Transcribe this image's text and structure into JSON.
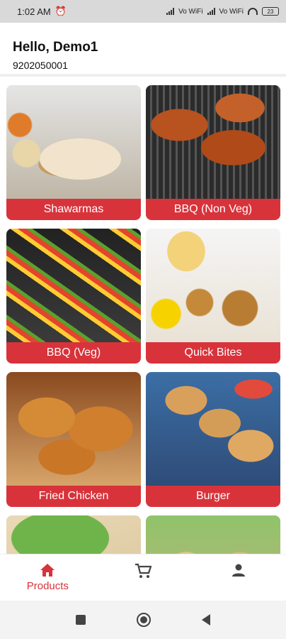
{
  "status_bar": {
    "time": "1:02 AM",
    "battery": "23",
    "net1": "Vo WiFi",
    "net2": "Vo WiFi"
  },
  "header": {
    "greeting": "Hello, Demo1",
    "phone": "9202050001"
  },
  "categories": [
    {
      "label": "Shawarmas",
      "icon": "shawarma-image"
    },
    {
      "label": "BBQ (Non Veg)",
      "icon": "bbq-nonveg-image"
    },
    {
      "label": "BBQ (Veg)",
      "icon": "bbq-veg-image"
    },
    {
      "label": "Quick Bites",
      "icon": "quick-bites-image"
    },
    {
      "label": "Fried Chicken",
      "icon": "fried-chicken-image"
    },
    {
      "label": "Burger",
      "icon": "burger-image"
    },
    {
      "label": "",
      "icon": "sandwich-image"
    },
    {
      "label": "",
      "icon": "wrap-image"
    }
  ],
  "bottom_nav": {
    "products_label": "Products",
    "active_color": "#d8333b",
    "items": [
      "home-icon",
      "cart-icon",
      "profile-icon"
    ]
  },
  "colors": {
    "accent": "#d8333b"
  }
}
